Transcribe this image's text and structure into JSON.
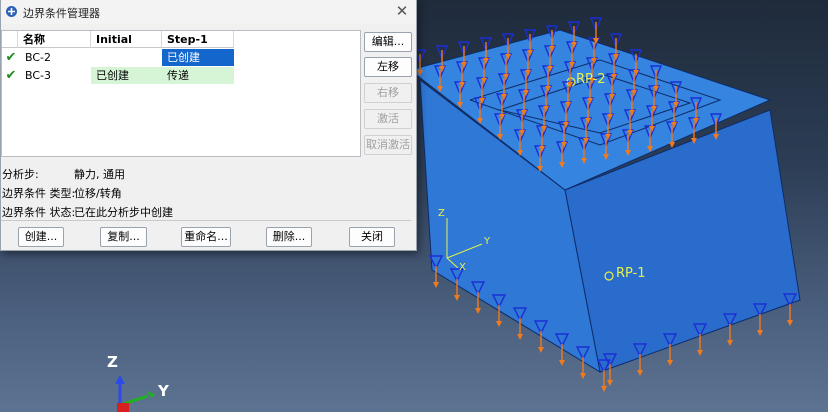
{
  "dialog": {
    "title": "边界条件管理器",
    "close_glyph": "✕",
    "table": {
      "headers": [
        "名称",
        "Initial",
        "Step-1"
      ],
      "rows": [
        {
          "check": "✔",
          "name": "BC-2",
          "initial": "",
          "step1": "已创建"
        },
        {
          "check": "✔",
          "name": "BC-3",
          "initial": "已创建",
          "step1": "传递"
        }
      ]
    },
    "side_buttons": {
      "edit": "编辑...",
      "move_left": "左移",
      "move_right": "右移",
      "activate": "激活",
      "deactivate": "取消激活"
    },
    "info": {
      "step_label": "分析步:",
      "step_value": "静力, 通用",
      "type_label": "边界条件 类型:",
      "type_value": "位移/转角",
      "status_label": "边界条件 状态:",
      "status_value": "已在此分析步中创建"
    },
    "bottom_buttons": {
      "create": "创建...",
      "copy": "复制...",
      "rename": "重命名...",
      "delete": "删除...",
      "close": "关闭"
    }
  },
  "viewport": {
    "ref_points": [
      "RP-2",
      "RP-1"
    ],
    "local_axes": {
      "z": "Z",
      "y": "Y",
      "x": "X"
    },
    "triad": {
      "z": "Z",
      "y": "Y"
    },
    "colors": {
      "part_top": "#2f78d6",
      "part_side": "#2466c4",
      "part_dark": "#1d56a8",
      "bc_cone": "#1a2fd6",
      "bc_arrow": "#f07a1e",
      "rp_label": "#e6f24a"
    }
  }
}
